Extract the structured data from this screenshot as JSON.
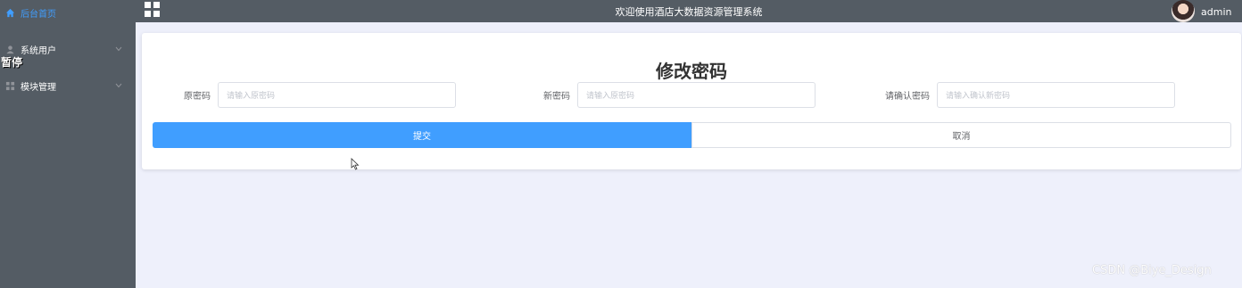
{
  "sidebar": {
    "items": [
      {
        "label": "后台首页",
        "icon": "home-icon"
      },
      {
        "label": "系统用户",
        "icon": "user-icon"
      },
      {
        "label": "模块管理",
        "icon": "grid-icon"
      }
    ],
    "paused_overlay": "暂停"
  },
  "header": {
    "title": "欢迎使用酒店大数据资源管理系统",
    "username": "admin"
  },
  "form": {
    "title": "修改密码",
    "fields": [
      {
        "label": "原密码",
        "placeholder": "请输入原密码"
      },
      {
        "label": "新密码",
        "placeholder": "请输入原密码"
      },
      {
        "label": "请确认密码",
        "placeholder": "请输入确认新密码"
      }
    ],
    "submit_label": "提交",
    "cancel_label": "取消"
  },
  "watermark": "CSDN @Biye_Design",
  "colors": {
    "sidebar_bg": "#545c64",
    "accent": "#409eff",
    "page_bg": "#eef0fb"
  }
}
